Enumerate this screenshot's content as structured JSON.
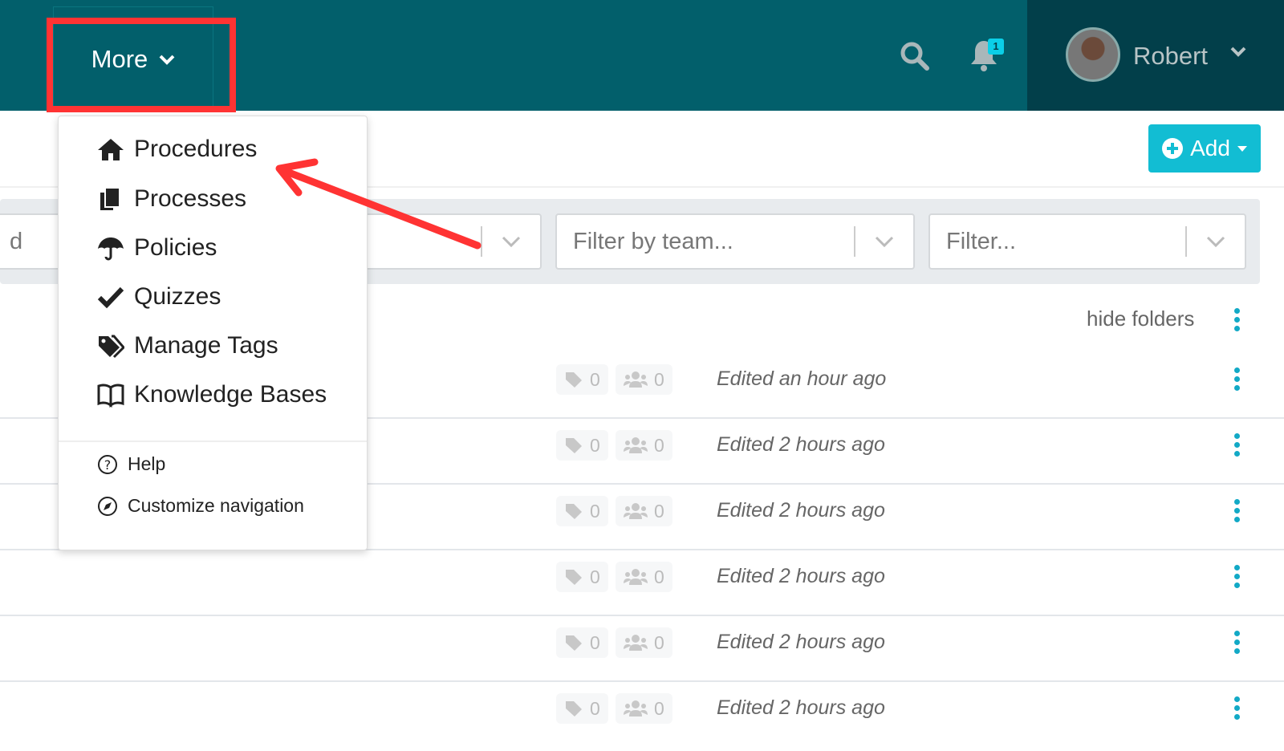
{
  "header": {
    "more_label": "More",
    "user_name": "Robert",
    "notification_count": "1"
  },
  "toolbar": {
    "add_label": "Add"
  },
  "filters": {
    "team_placeholder": "Filter by team...",
    "filter_placeholder": "Filter...",
    "first_partial": "d"
  },
  "list": {
    "hide_folders": "hide folders",
    "rows": [
      {
        "tags": "0",
        "members": "0",
        "edited": "Edited an hour ago"
      },
      {
        "tags": "0",
        "members": "0",
        "edited": "Edited 2 hours ago"
      },
      {
        "tags": "0",
        "members": "0",
        "edited": "Edited 2 hours ago"
      },
      {
        "tags": "0",
        "members": "0",
        "edited": "Edited 2 hours ago"
      },
      {
        "tags": "0",
        "members": "0",
        "edited": "Edited 2 hours ago"
      },
      {
        "tags": "0",
        "members": "0",
        "edited": "Edited 2 hours ago"
      }
    ]
  },
  "menu": {
    "items": [
      {
        "label": "Procedures",
        "icon": "home-icon"
      },
      {
        "label": "Processes",
        "icon": "copy-icon"
      },
      {
        "label": "Policies",
        "icon": "umbrella-icon"
      },
      {
        "label": "Quizzes",
        "icon": "check-icon"
      },
      {
        "label": "Manage Tags",
        "icon": "tags-icon"
      },
      {
        "label": "Knowledge Bases",
        "icon": "book-icon"
      }
    ],
    "secondary": [
      {
        "label": "Help",
        "icon": "question-circle-icon"
      },
      {
        "label": "Customize navigation",
        "icon": "compass-icon"
      }
    ]
  },
  "colors": {
    "header": "#025f6b",
    "header_user": "#023f4a",
    "accent": "#12bdd3",
    "annotation": "#ff3333"
  }
}
